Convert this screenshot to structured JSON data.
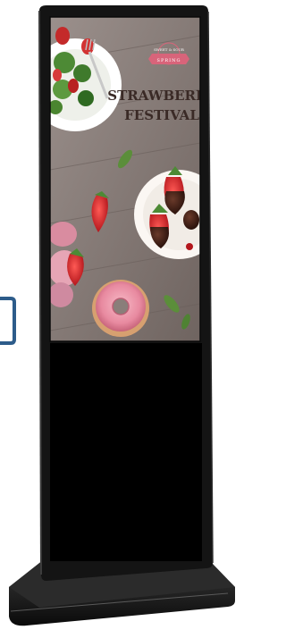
{
  "poster": {
    "badge_line1": "SWEET & SOUR",
    "badge_line2": "SPRING",
    "title_line1": "STRAWBERRY",
    "title_line2": "FESTIVAL"
  },
  "colors": {
    "frame": "#141414",
    "lower_panel": "#000000",
    "base": "#1a1a1a",
    "wood": "#8a7e7a",
    "ribbon": "#d8647a",
    "title_text": "#3a2a26",
    "side_bracket": "#2d5c8a"
  }
}
